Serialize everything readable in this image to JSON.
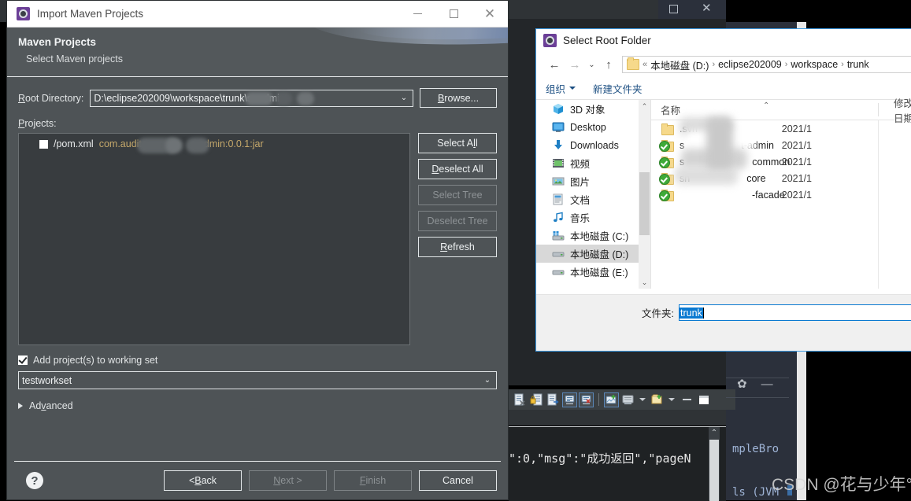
{
  "maven_dialog": {
    "title": "Import Maven Projects",
    "icon": "maven-window-icon",
    "window_buttons": {
      "minimize": "minimize-button",
      "maximize": "maximize-button",
      "close": "close-button"
    },
    "banner": {
      "heading": "Maven Projects",
      "subheading": "Select Maven projects"
    },
    "root_directory": {
      "label": "Root Directory:",
      "value": "D:\\eclipse202009\\workspace\\trunk\\sr           admin",
      "value_prefix": "D:\\eclipse202009\\workspace\\trunk\\sr",
      "value_suffix": "admin",
      "dropdown_icon": "chevron-down-icon",
      "browse_button": "Browse..."
    },
    "projects": {
      "label": "Projects:",
      "rows": [
        {
          "checked": false,
          "path": "/pom.xml",
          "coordinates": "com.audit",
          "coordinates_suffix": "dmin:0.0.1:jar"
        }
      ],
      "buttons": [
        {
          "label": "Select All",
          "enabled": true
        },
        {
          "label": "Deselect All",
          "enabled": true
        },
        {
          "label": "Select Tree",
          "enabled": false
        },
        {
          "label": "Deselect Tree",
          "enabled": false
        },
        {
          "label": "Refresh",
          "enabled": true
        }
      ]
    },
    "working_set": {
      "checkbox_label": "Add project(s) to working set",
      "checked": true,
      "value": "testworkset",
      "dropdown_icon": "chevron-down-icon"
    },
    "advanced": {
      "label": "Advanced",
      "expanded": false,
      "icon": "expand-triangle-icon"
    },
    "footer": {
      "help_icon": "help-icon",
      "buttons": [
        {
          "label": "< Back",
          "enabled": true
        },
        {
          "label": "Next >",
          "enabled": false
        },
        {
          "label": "Finish",
          "enabled": false
        },
        {
          "label": "Cancel",
          "enabled": true
        }
      ]
    }
  },
  "windows_dialog": {
    "title": "Select Root Folder",
    "icon": "maven-window-icon",
    "nav": {
      "back_icon": "arrow-left-icon",
      "forward_icon": "arrow-right-icon",
      "recent_icon": "chevron-down-icon",
      "up_icon": "arrow-up-icon",
      "folder_icon": "folder-icon",
      "overflow": "«",
      "breadcrumbs": [
        "本地磁盘 (D:)",
        "eclipse202009",
        "workspace",
        "trunk"
      ]
    },
    "commandbar": {
      "organize": "组织",
      "new_folder": "新建文件夹"
    },
    "tree": {
      "items": [
        {
          "label": "3D 对象",
          "icon": "3d-object-icon",
          "selected": false
        },
        {
          "label": "Desktop",
          "icon": "desktop-icon",
          "selected": false
        },
        {
          "label": "Downloads",
          "icon": "downloads-icon",
          "selected": false
        },
        {
          "label": "视频",
          "icon": "video-icon",
          "selected": false
        },
        {
          "label": "图片",
          "icon": "pictures-icon",
          "selected": false
        },
        {
          "label": "文档",
          "icon": "documents-icon",
          "selected": false
        },
        {
          "label": "音乐",
          "icon": "music-icon",
          "selected": false
        },
        {
          "label": "本地磁盘 (C:)",
          "icon": "drive-system-icon",
          "selected": false
        },
        {
          "label": "本地磁盘 (D:)",
          "icon": "drive-icon",
          "selected": true
        },
        {
          "label": "本地磁盘 (E:)",
          "icon": "drive-icon",
          "selected": false
        }
      ]
    },
    "files": {
      "columns": [
        "名称",
        "修改日期"
      ],
      "sort_indicator": "sort-ascending-icon",
      "rows": [
        {
          "name": ".svn",
          "icon": "folder-icon",
          "date": "2021/1"
        },
        {
          "name": "t-admin",
          "icon": "folder-svn-icon",
          "date": "2021/1",
          "prefix": "s"
        },
        {
          "name": "common",
          "icon": "folder-svn-icon",
          "date": "2021/1",
          "prefix": "s"
        },
        {
          "name": "core",
          "icon": "folder-svn-icon",
          "date": "2021/1",
          "prefix": "sn"
        },
        {
          "name": "-facade",
          "icon": "folder-svn-icon",
          "date": "2021/1",
          "prefix": ""
        }
      ]
    },
    "folder_field": {
      "label": "文件夹:",
      "value": "trunk",
      "selected": true
    }
  },
  "ide_background": {
    "console_text": "\":0,\"msg\":\"成功返回\",\"pageN",
    "side_labels": [
      "mpleBro",
      "ls (JVM"
    ],
    "toolbar_icons": [
      "remove-all-terminated-icon",
      "lock-scroll-icon",
      "open-console-icon",
      "display-selected-console-icon",
      "close-console-icon",
      "new-console-view-icon",
      "pin-console-icon",
      "open-console-dropdown-icon",
      "minimize-view-icon",
      "maximize-view-icon"
    ],
    "view_controls": [
      "view-menu-gear-icon",
      "minimize-icon"
    ],
    "scroll_up_icon": "scroll-up-arrow-icon"
  },
  "watermark": {
    "text": "CSDN @花与少年°"
  }
}
